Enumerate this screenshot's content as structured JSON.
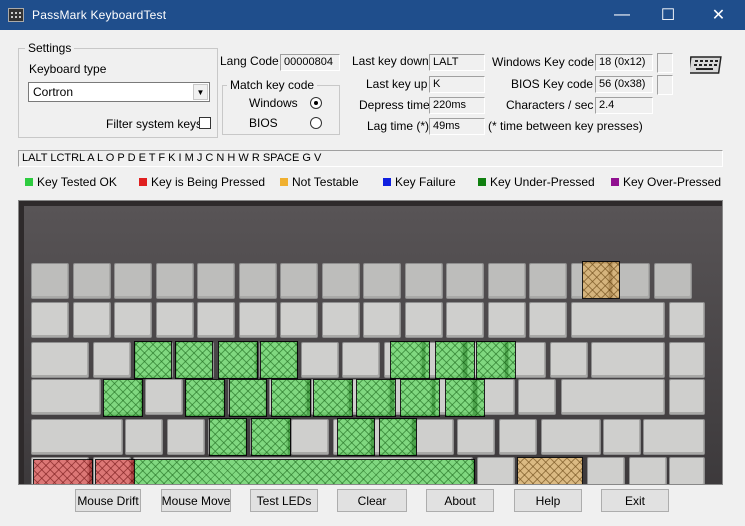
{
  "window": {
    "title": "PassMark KeyboardTest",
    "minimize": "—",
    "maximize": "☐",
    "close": "✕"
  },
  "settings": {
    "group_label": "Settings",
    "keyboard_type_label": "Keyboard type",
    "keyboard_type_value": "Cortron",
    "filter_label": "Filter system keys",
    "lang_code_label": "Lang Code",
    "lang_code_value": "00000804",
    "match_label": "Match key code",
    "match_windows": "Windows",
    "match_bios": "BIOS",
    "last_key_down_label": "Last key down",
    "last_key_down_value": "LALT",
    "last_key_up_label": "Last key up",
    "last_key_up_value": "K",
    "depress_label": "Depress time",
    "depress_value": "220ms",
    "lag_label": "Lag time (*)",
    "lag_value": "49ms",
    "win_key_label": "Windows Key code",
    "win_key_value": "18 (0x12)",
    "bios_key_label": "BIOS Key code",
    "bios_key_value": "56 (0x38)",
    "cps_label": "Characters / sec",
    "cps_value": "2.4",
    "lag_note": "(* time between key presses)"
  },
  "key_log": "LALT LCTRL A L O P D E T F K I M J C N H W R SPACE G V",
  "legend": [
    {
      "label": "Key Tested OK",
      "color": "#2ecc40"
    },
    {
      "label": "Key is Being Pressed",
      "color": "#e02020"
    },
    {
      "label": "Not Testable",
      "color": "#f0b030"
    },
    {
      "label": "Key Failure",
      "color": "#1020e0"
    },
    {
      "label": "Key Under-Pressed",
      "color": "#108010"
    },
    {
      "label": "Key Over-Pressed",
      "color": "#901090"
    }
  ],
  "buttons": {
    "mouse_drift": "Mouse Drift",
    "mouse_move": "Mouse Move",
    "test_leds": "Test LEDs",
    "clear": "Clear",
    "about": "About",
    "help": "Help",
    "exit": "Exit"
  }
}
